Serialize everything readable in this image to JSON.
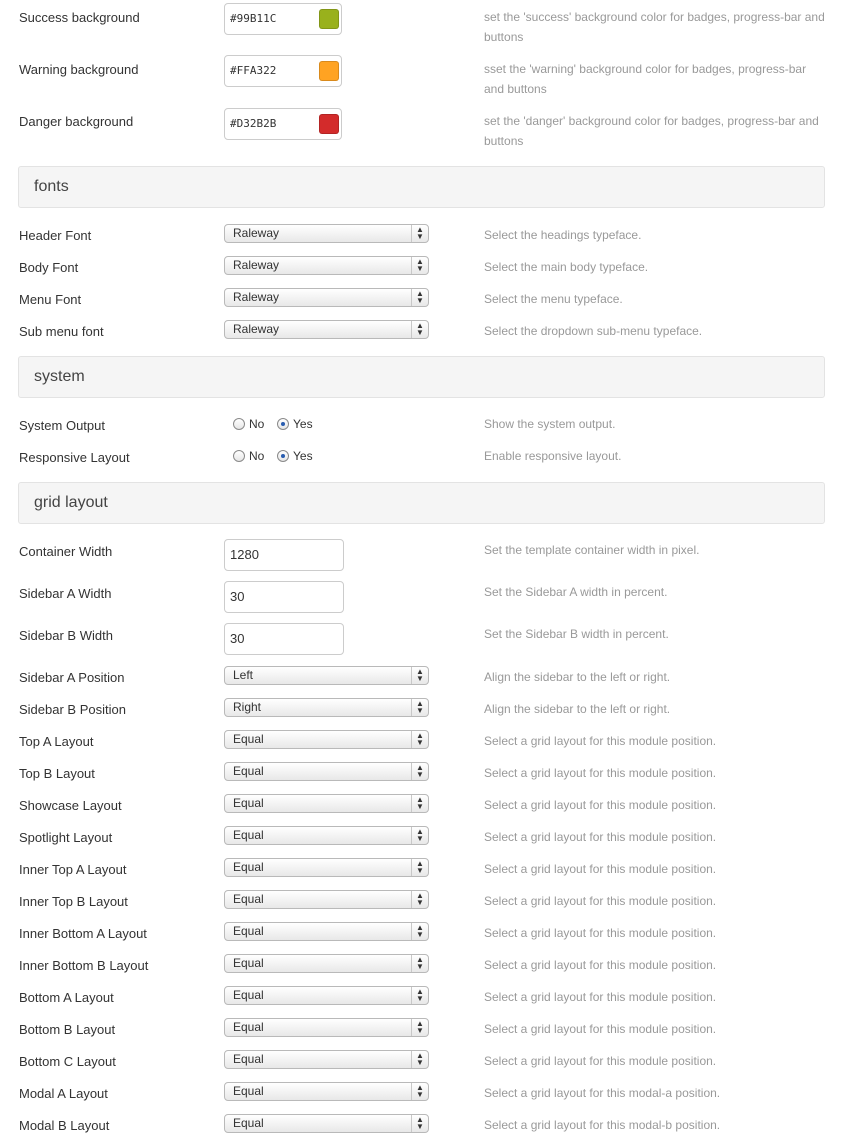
{
  "colors": [
    {
      "label": "Success background",
      "value": "#99B11C",
      "swatch": "#99B11C",
      "desc": "set the 'success' background color for badges, progress-bar and buttons"
    },
    {
      "label": "Warning background",
      "value": "#FFA322",
      "swatch": "#FFA322",
      "desc": "sset the 'warning' background color for badges, progress-bar and buttons"
    },
    {
      "label": "Danger background",
      "value": "#D32B2B",
      "swatch": "#D32B2B",
      "desc": "set the 'danger' background color for badges, progress-bar and buttons"
    }
  ],
  "sections": {
    "fonts": "fonts",
    "system": "system",
    "grid": "grid layout"
  },
  "fonts": [
    {
      "label": "Header Font",
      "value": "Raleway",
      "desc": "Select the headings typeface."
    },
    {
      "label": "Body Font",
      "value": "Raleway",
      "desc": "Select the main body typeface."
    },
    {
      "label": "Menu Font",
      "value": "Raleway",
      "desc": "Select the menu typeface."
    },
    {
      "label": "Sub menu font",
      "value": "Raleway",
      "desc": "Select the dropdown sub-menu typeface."
    }
  ],
  "system": [
    {
      "label": "System Output",
      "no": "No",
      "yes": "Yes",
      "selected": "yes",
      "desc": "Show the system output."
    },
    {
      "label": "Responsive Layout",
      "no": "No",
      "yes": "Yes",
      "selected": "yes",
      "desc": "Enable responsive layout."
    }
  ],
  "grid_inputs": [
    {
      "label": "Container Width",
      "value": "1280",
      "desc": "Set the template container width in pixel."
    },
    {
      "label": "Sidebar A Width",
      "value": "30",
      "desc": "Set the Sidebar A width in percent."
    },
    {
      "label": "Sidebar B Width",
      "value": "30",
      "desc": "Set the Sidebar B width in percent."
    }
  ],
  "grid_selects": [
    {
      "label": "Sidebar A Position",
      "value": "Left",
      "desc": "Align the sidebar to the left or right."
    },
    {
      "label": "Sidebar B Position",
      "value": "Right",
      "desc": "Align the sidebar to the left or right."
    },
    {
      "label": "Top A Layout",
      "value": "Equal",
      "desc": "Select a grid layout for this module position."
    },
    {
      "label": "Top B Layout",
      "value": "Equal",
      "desc": "Select a grid layout for this module position."
    },
    {
      "label": "Showcase Layout",
      "value": "Equal",
      "desc": "Select a grid layout for this module position."
    },
    {
      "label": "Spotlight Layout",
      "value": "Equal",
      "desc": "Select a grid layout for this module position."
    },
    {
      "label": "Inner Top A Layout",
      "value": "Equal",
      "desc": "Select a grid layout for this module position."
    },
    {
      "label": "Inner Top B Layout",
      "value": "Equal",
      "desc": "Select a grid layout for this module position."
    },
    {
      "label": "Inner Bottom A Layout",
      "value": "Equal",
      "desc": "Select a grid layout for this module position."
    },
    {
      "label": "Inner Bottom B Layout",
      "value": "Equal",
      "desc": "Select a grid layout for this module position."
    },
    {
      "label": "Bottom A Layout",
      "value": "Equal",
      "desc": "Select a grid layout for this module position."
    },
    {
      "label": "Bottom B Layout",
      "value": "Equal",
      "desc": "Select a grid layout for this module position."
    },
    {
      "label": "Bottom C Layout",
      "value": "Equal",
      "desc": "Select a grid layout for this module position."
    },
    {
      "label": "Modal A Layout",
      "value": "Equal",
      "desc": "Select a grid layout for this modal-a position."
    },
    {
      "label": "Modal B Layout",
      "value": "Equal",
      "desc": "Select a grid layout for this modal-b position."
    }
  ]
}
